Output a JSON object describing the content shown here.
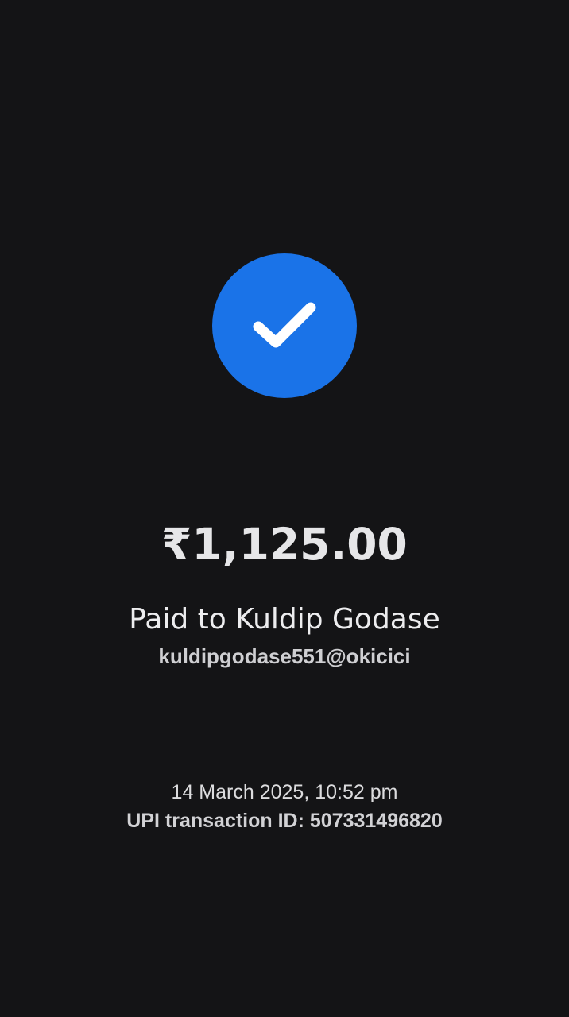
{
  "status": {
    "icon": "checkmark-icon",
    "accent_color": "#1a73e8",
    "background_color": "#141416"
  },
  "payment": {
    "amount": "₹1,125.00",
    "paid_to": "Paid to Kuldip Godase",
    "upi_id": "kuldipgodase551@okicici"
  },
  "details": {
    "datetime": "14 March 2025, 10:52 pm",
    "transaction_id": "UPI transaction ID: 507331496820"
  }
}
